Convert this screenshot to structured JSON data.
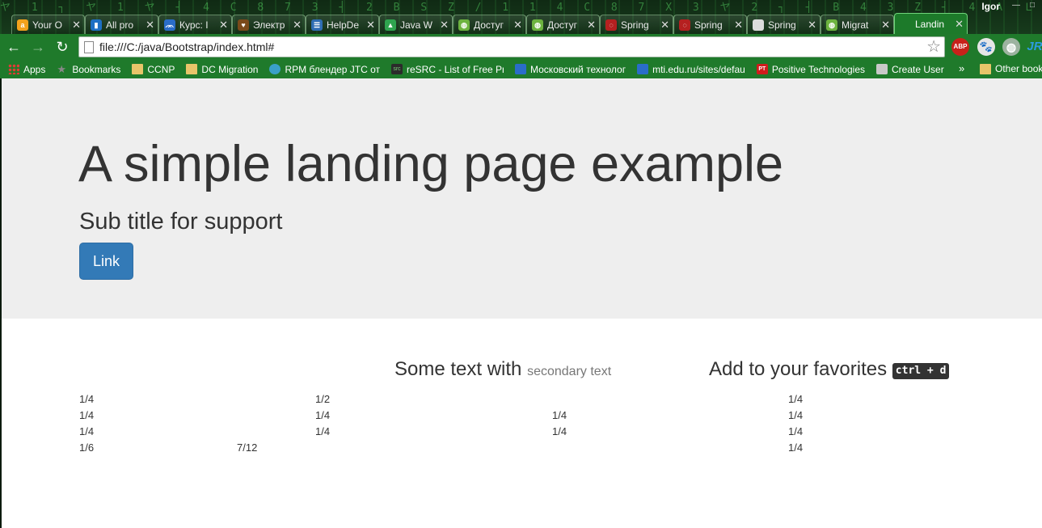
{
  "window": {
    "user": "Igor",
    "matrix_text": "ヤ 1 ┐ ヤ 1 ヤ ┤ 4 C 8 7 3 ┤ 2 B S Z / 1 1 4 C 8 7 X 3 ヤ 2 ┐ ┤ B 4 3 Z ┤ 4 A Ｌ",
    "controls": [
      "—",
      "□"
    ]
  },
  "tabs": [
    {
      "label": "Your O",
      "fav_color": "#f3a21c",
      "fav_glyph": "a",
      "active": false
    },
    {
      "label": "All pro",
      "fav_color": "#1d6fc4",
      "fav_glyph": "▮",
      "active": false
    },
    {
      "label": "Курс: I",
      "fav_color": "#2a6dc9",
      "fav_glyph": "ᨏ",
      "active": false
    },
    {
      "label": "Электр",
      "fav_color": "#7a4a1a",
      "fav_glyph": "♥",
      "active": false
    },
    {
      "label": "HelpDe",
      "fav_color": "#2f6db3",
      "fav_glyph": "☰",
      "active": false
    },
    {
      "label": "Java W",
      "fav_color": "#2fa44f",
      "fav_glyph": "▲",
      "active": false
    },
    {
      "label": "Достуг",
      "fav_color": "#6db33f",
      "fav_glyph": "◍",
      "active": false
    },
    {
      "label": "Достуг",
      "fav_color": "#6db33f",
      "fav_glyph": "◍",
      "active": false
    },
    {
      "label": "Spring",
      "fav_color": "#b52020",
      "fav_glyph": "◌",
      "active": false
    },
    {
      "label": "Spring",
      "fav_color": "#b52020",
      "fav_glyph": "◌",
      "active": false
    },
    {
      "label": "Spring",
      "fav_color": "#dcdcdc",
      "fav_glyph": "",
      "active": false
    },
    {
      "label": "Migrat",
      "fav_color": "#6db33f",
      "fav_glyph": "◍",
      "active": false
    },
    {
      "label": "Landin",
      "fav_color": "#1d7a2a",
      "fav_glyph": "",
      "active": true
    }
  ],
  "toolbar": {
    "back": "←",
    "forward": "→",
    "reload": "↻",
    "url": "file:///C:/java/Bootstrap/index.html#",
    "star": "☆",
    "ext_abp": "ABP",
    "ext_cat": "🐾",
    "ext_globe": "◍",
    "ext_jr": "JR"
  },
  "bookmarks": {
    "items": [
      {
        "label": "Apps",
        "icon": "grid"
      },
      {
        "label": "Bookmarks",
        "icon": "star"
      },
      {
        "label": "CCNP",
        "icon": "folder"
      },
      {
        "label": "DC Migration",
        "icon": "folder"
      },
      {
        "label": "RPM блендер JTC от",
        "icon": "teal"
      },
      {
        "label": "reSRC - List of Free Pr",
        "icon": "dark"
      },
      {
        "label": "Московский технолог",
        "icon": "blue"
      },
      {
        "label": "mti.edu.ru/sites/defau",
        "icon": "blue"
      },
      {
        "label": "Positive Technologies",
        "icon": "red"
      },
      {
        "label": "Create User",
        "icon": "gray"
      }
    ],
    "more": "»",
    "other": "Other book"
  },
  "jumbotron": {
    "title": "A simple landing page example",
    "subtitle": "Sub title for support",
    "button": "Link"
  },
  "headings": {
    "h1_main": "Some text with",
    "h1_small": "secondary text",
    "h2_main": "Add to your favorites",
    "h2_kbd": "ctrl + d"
  },
  "grid_rows": [
    [
      "1/4",
      "1/2",
      "1/4"
    ],
    [
      "1/4",
      "1/4",
      "1/4",
      "1/4"
    ],
    [
      "1/4",
      "1/4",
      "1/4",
      "1/4"
    ],
    [
      "1/6",
      "7/12",
      "1/4"
    ]
  ]
}
